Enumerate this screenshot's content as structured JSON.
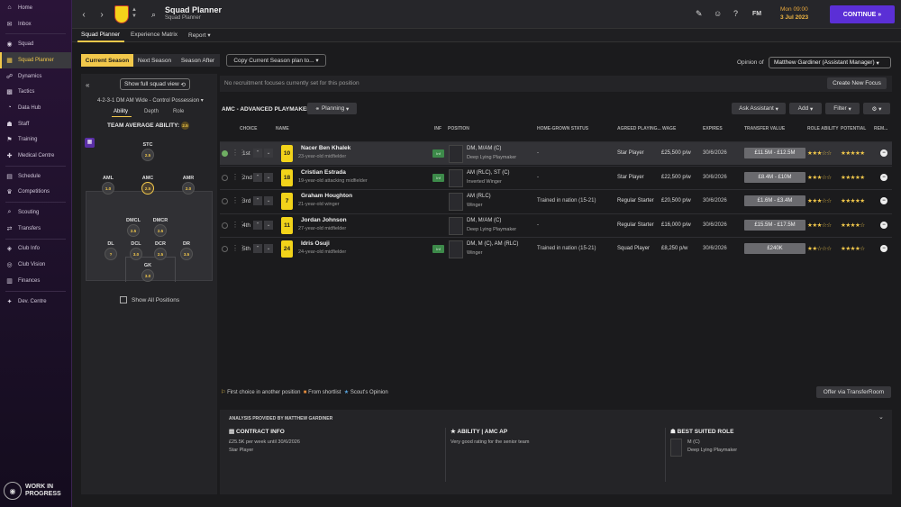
{
  "sidebar": {
    "items": [
      {
        "label": "Home",
        "icon": "home-icon",
        "glyph": "⌂"
      },
      {
        "label": "Inbox",
        "icon": "inbox-icon",
        "glyph": "✉"
      },
      {
        "label": "Squad",
        "icon": "squad-icon",
        "glyph": "◉"
      },
      {
        "label": "Squad Planner",
        "icon": "squad-planner-icon",
        "glyph": "▦"
      },
      {
        "label": "Dynamics",
        "icon": "dynamics-icon",
        "glyph": "☍"
      },
      {
        "label": "Tactics",
        "icon": "tactics-icon",
        "glyph": "▩"
      },
      {
        "label": "Data Hub",
        "icon": "data-hub-icon",
        "glyph": "◔"
      },
      {
        "label": "Staff",
        "icon": "staff-icon",
        "glyph": "☗"
      },
      {
        "label": "Training",
        "icon": "training-icon",
        "glyph": "⚑"
      },
      {
        "label": "Medical Centre",
        "icon": "medical-icon",
        "glyph": "✚"
      },
      {
        "label": "Schedule",
        "icon": "schedule-icon",
        "glyph": "▤"
      },
      {
        "label": "Competitions",
        "icon": "competitions-icon",
        "glyph": "♛"
      },
      {
        "label": "Scouting",
        "icon": "scouting-icon",
        "glyph": "⌕"
      },
      {
        "label": "Transfers",
        "icon": "transfers-icon",
        "glyph": "⇄"
      },
      {
        "label": "Club Info",
        "icon": "club-info-icon",
        "glyph": "◈"
      },
      {
        "label": "Club Vision",
        "icon": "club-vision-icon",
        "glyph": "◎"
      },
      {
        "label": "Finances",
        "icon": "finances-icon",
        "glyph": "▥"
      },
      {
        "label": "Dev. Centre",
        "icon": "dev-centre-icon",
        "glyph": "✦"
      }
    ],
    "active_index": 3,
    "wip_line1": "WORK IN",
    "wip_line2": "PROGRESS"
  },
  "header": {
    "title": "Squad Planner",
    "subtitle": "Squad Planner",
    "fm": "FM",
    "date_time": "Mon 09:00",
    "date": "3 Jul 2023",
    "continue_label": "CONTINUE"
  },
  "subtabs": [
    "Squad Planner",
    "Experience Matrix",
    "Report"
  ],
  "seasons": [
    "Current Season",
    "Next Season",
    "Season After"
  ],
  "copy_plan": "Copy Current Season plan to...",
  "opinion": {
    "label": "Opinion of",
    "value": "Matthew Gardiner (Assistant Manager)"
  },
  "pitch_panel": {
    "full_squad_btn": "Show full squad view",
    "formation": "4-2-3-1 DM AM Wide - Control Possession",
    "tabs": [
      "Ability",
      "Depth",
      "Role"
    ],
    "team_avg": "TEAM AVERAGE ABILITY:",
    "team_avg_value": "2.5",
    "show_all": "Show All Positions",
    "positions": [
      {
        "lbl": "STC",
        "val": "2.5"
      },
      {
        "lbl": "AML",
        "val": "1.0"
      },
      {
        "lbl": "AMC",
        "val": "2.5"
      },
      {
        "lbl": "AMR",
        "val": "2.0"
      },
      {
        "lbl": "DMCL",
        "val": "2.5"
      },
      {
        "lbl": "DMCR",
        "val": "2.5"
      },
      {
        "lbl": "DL",
        "val": "?"
      },
      {
        "lbl": "DCL",
        "val": "3.0"
      },
      {
        "lbl": "DCR",
        "val": "2.5"
      },
      {
        "lbl": "DR",
        "val": "3.5"
      },
      {
        "lbl": "GK",
        "val": "3.0"
      }
    ]
  },
  "focus": {
    "no_recruit": "No recruitment focuses currently set for this position",
    "new_focus_btn": "Create New Focus"
  },
  "table": {
    "role_title": "AMC - ADVANCED PLAYMAKER",
    "planning_btn": "Planning",
    "tools": [
      "Ask Assistant",
      "Add",
      "Filter",
      ""
    ],
    "headers": [
      "CHOICE",
      "NAME",
      "INF",
      "POSITION",
      "HOME-GROWN STATUS",
      "AGREED PLAYING...",
      "WAGE",
      "EXPIRES",
      "TRANSFER VALUE",
      "ROLE ABILITY",
      "POTENTIAL",
      "REM..."
    ],
    "rows": [
      {
        "choice": "1st",
        "num": "10",
        "name": "Nacer Ben Khalek",
        "desc": "23-year-old midfielder",
        "inf": "Inf",
        "pos": "DM, M/AM (C)",
        "role": "Deep Lying Playmaker",
        "hg": "-",
        "playing": "Star Player",
        "wage": "£25,500 p/w",
        "expires": "30/6/2026",
        "tv": "£11.5M - £12.5M",
        "ra": "★★★☆☆",
        "pot": "★★★★★"
      },
      {
        "choice": "2nd",
        "num": "18",
        "name": "Cristian Estrada",
        "desc": "19-year-old attacking midfielder",
        "inf": "Inf",
        "pos": "AM (RLC), ST (C)",
        "role": "Inverted Winger",
        "hg": "-",
        "playing": "Star Player",
        "wage": "£22,500 p/w",
        "expires": "30/6/2026",
        "tv": "£8.4M - £10M",
        "ra": "★★★☆☆",
        "pot": "★★★★★"
      },
      {
        "choice": "3rd",
        "num": "7",
        "name": "Graham Houghton",
        "desc": "21-year-old winger",
        "inf": "",
        "pos": "AM (RLC)",
        "role": "Winger",
        "hg": "Trained in nation (15-21)",
        "playing": "Regular Starter",
        "wage": "£20,500 p/w",
        "expires": "30/6/2026",
        "tv": "£1.6M - £3.4M",
        "ra": "★★★☆☆",
        "pot": "★★★★★"
      },
      {
        "choice": "4th",
        "num": "11",
        "name": "Jordan Johnson",
        "desc": "27-year-old midfielder",
        "inf": "",
        "pos": "DM, M/AM (C)",
        "role": "Deep Lying Playmaker",
        "hg": "-",
        "playing": "Regular Starter",
        "wage": "£16,000 p/w",
        "expires": "30/6/2026",
        "tv": "£15.5M - £17.5M",
        "ra": "★★★☆☆",
        "pot": "★★★★☆"
      },
      {
        "choice": "5th",
        "num": "24",
        "name": "Idris Osuji",
        "desc": "24-year-old midfielder",
        "inf": "Inf",
        "pos": "DM, M (C), AM (RLC)",
        "role": "Winger",
        "hg": "Trained in nation (15-21)",
        "playing": "Squad Player",
        "wage": "£8,250 p/w",
        "expires": "30/6/2026",
        "tv": "£240K",
        "ra": "★★☆☆☆",
        "pot": "★★★★☆"
      }
    ]
  },
  "legend": {
    "first": "First choice in another position",
    "shortlist": "From shortlist",
    "scout": "Scout's Opinion"
  },
  "offer_btn": "Offer via TransferRoom",
  "analysis": {
    "title": "ANALYSIS PROVIDED BY MATTHEW GARDINER",
    "contract_h": "CONTRACT INFO",
    "contract_1": "£25.5K per week until 30/6/2026",
    "contract_2": "Star Player",
    "ability_h": "ABILITY | AMC AP",
    "ability_1": "Very good rating for the senior team",
    "role_h": "BEST SUITED ROLE",
    "role_pos": "M (C)",
    "role_name": "Deep Lying Playmaker"
  }
}
